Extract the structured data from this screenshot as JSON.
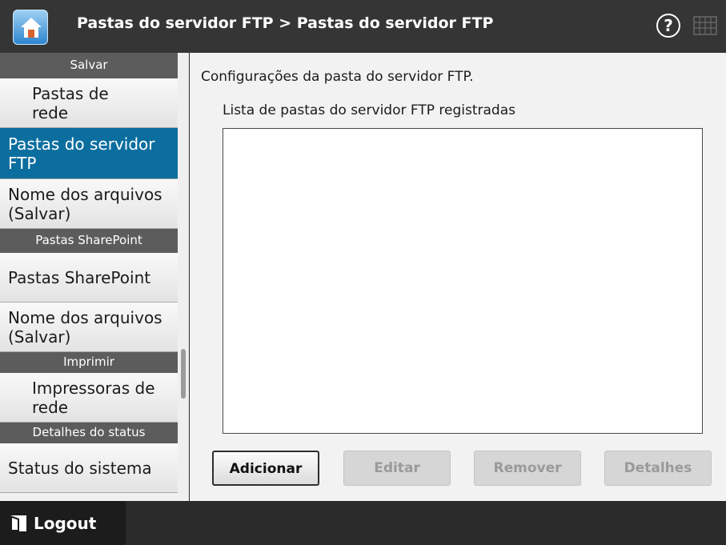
{
  "header": {
    "title": "Pastas do servidor FTP > Pastas do servidor FTP",
    "help_symbol": "?",
    "home_icon": "home-icon",
    "keyboard_icon": "keyboard-icon"
  },
  "sidebar": {
    "sections": [
      {
        "label": "Salvar",
        "items": [
          {
            "label": "Pastas de rede",
            "lines": [
              "Pastas de",
              "rede"
            ]
          },
          {
            "label": "Pastas do servidor FTP",
            "lines": [
              "Pastas do servidor",
              "FTP"
            ],
            "selected": true
          },
          {
            "label": "Nome dos arquivos (Salvar)",
            "lines": [
              "Nome dos arquivos",
              "(Salvar)"
            ]
          }
        ]
      },
      {
        "label": "Pastas SharePoint",
        "items": [
          {
            "label": "Pastas SharePoint",
            "lines": [
              "Pastas SharePoint"
            ]
          },
          {
            "label": "Nome dos arquivos (Salvar)",
            "lines": [
              "Nome dos arquivos",
              "(Salvar)"
            ]
          }
        ]
      },
      {
        "label": "Imprimir",
        "items": [
          {
            "label": "Impressoras de rede",
            "lines": [
              "Impressoras de",
              "rede"
            ]
          }
        ]
      },
      {
        "label": "Detalhes do status",
        "items": [
          {
            "label": "Status do sistema",
            "lines": [
              "Status do sistema"
            ]
          }
        ]
      }
    ]
  },
  "main": {
    "description": "Configurações da pasta do servidor FTP.",
    "list_label": "Lista de pastas do servidor FTP registradas",
    "list_items": [],
    "buttons": {
      "add": "Adicionar",
      "edit": "Editar",
      "remove": "Remover",
      "details": "Detalhes"
    }
  },
  "footer": {
    "logout_label": "Logout",
    "logout_icon": "logout-icon"
  },
  "colors": {
    "header_bg": "#353535",
    "selected_item": "#0c6e9f",
    "section_bg": "#5c5c5c"
  }
}
